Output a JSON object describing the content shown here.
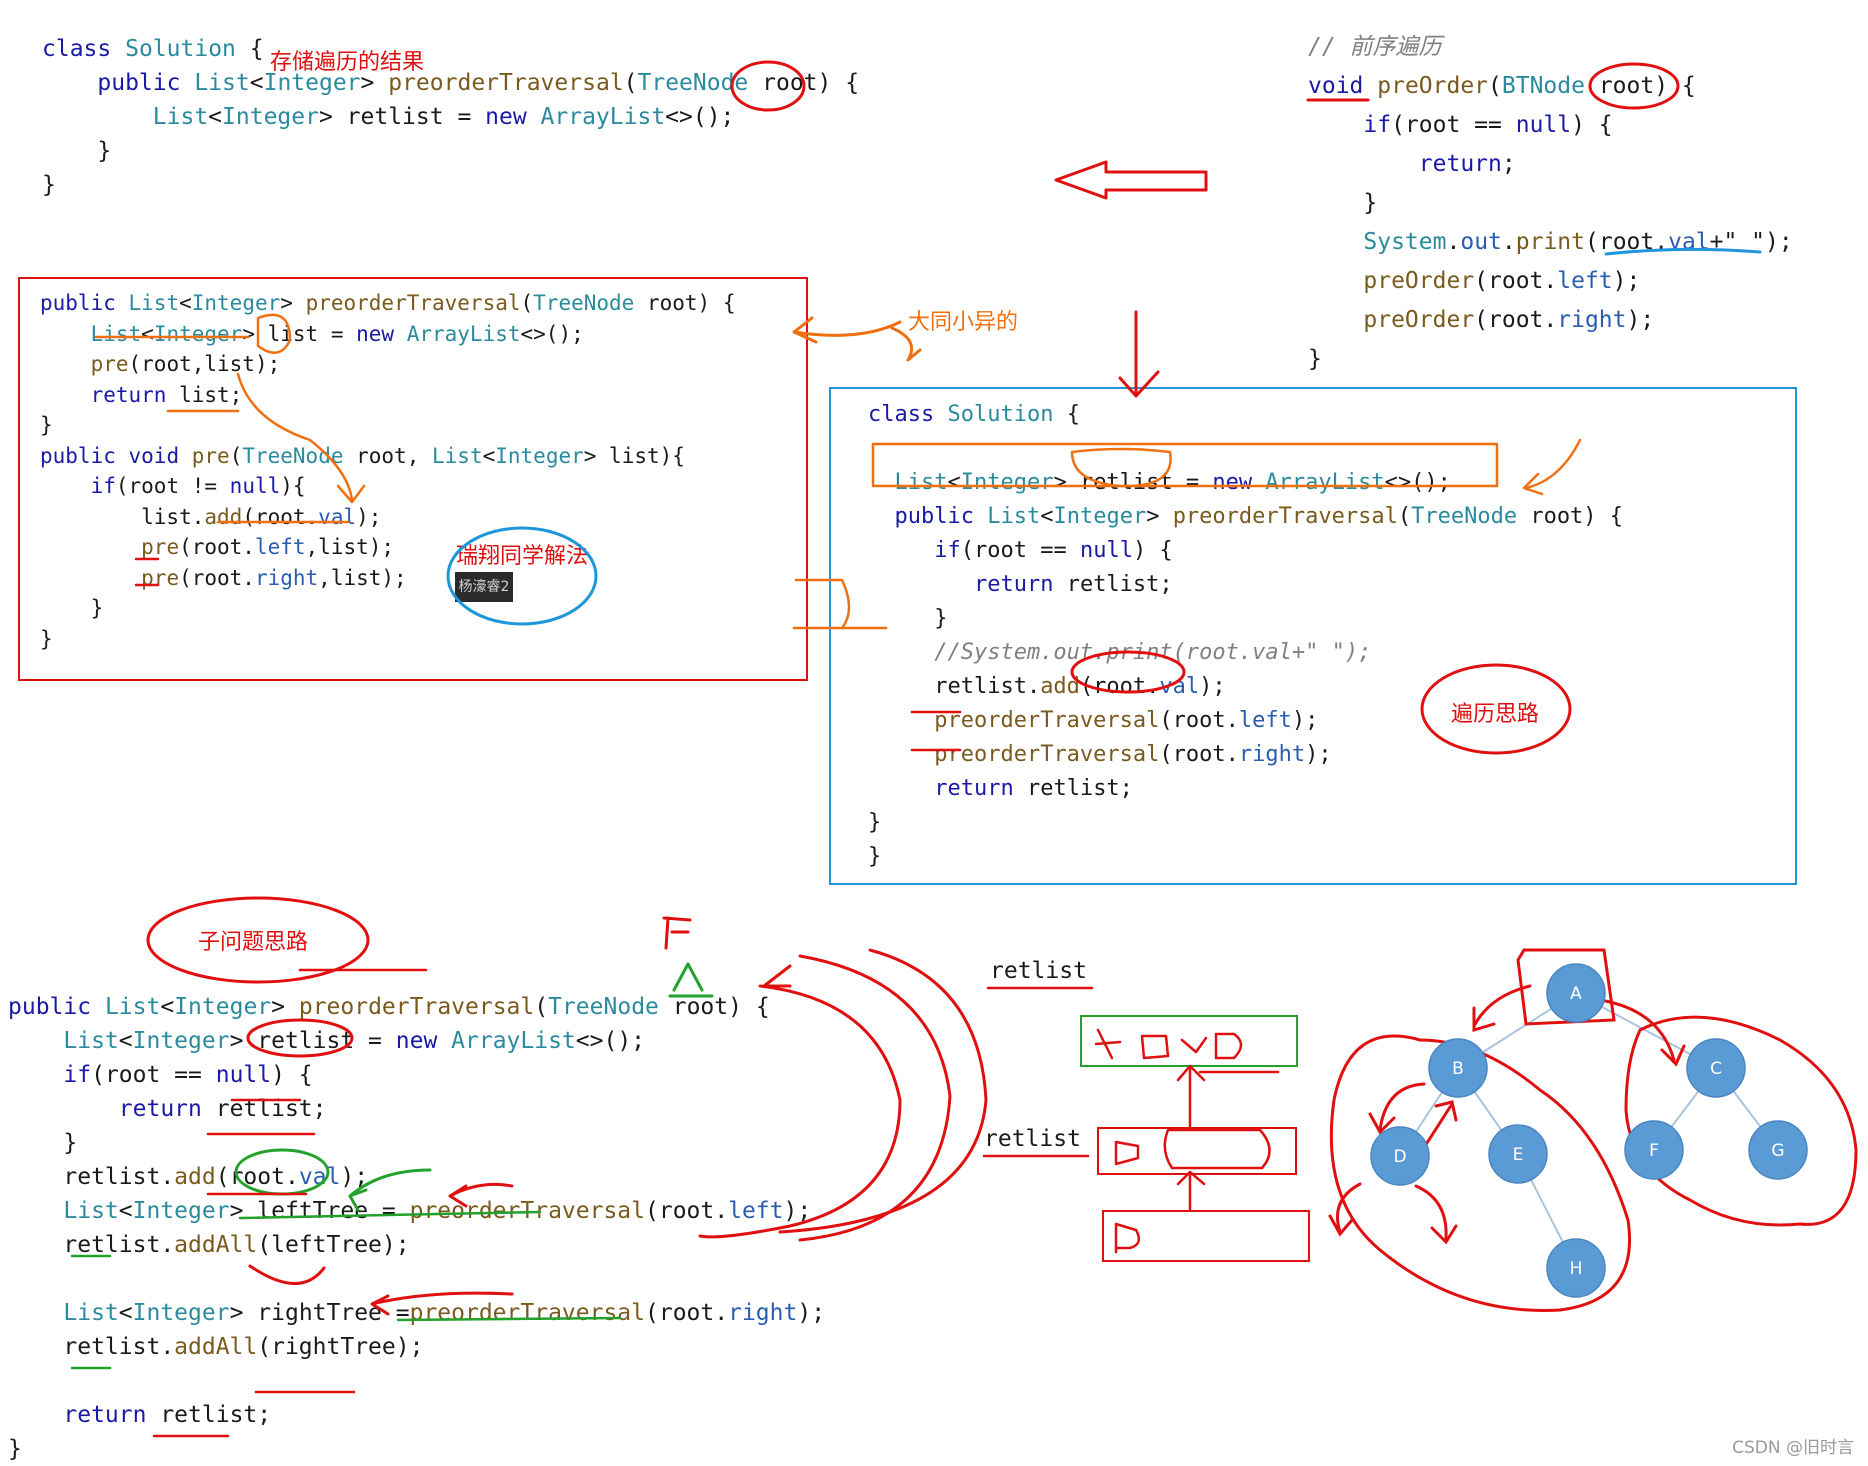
{
  "panel_top_left": {
    "lines": [
      "class Solution {",
      "    public List<Integer> preorderTraversal(TreeNode root) {",
      "        List<Integer> retlist = new ArrayList<>();",
      "    }",
      "}"
    ]
  },
  "panel_top_right": {
    "lines": [
      "// 前序遍历",
      "void preOrder(BTNode root) {",
      "    if(root == null) {",
      "        return;",
      "    }",
      "    System.out.print(root.val+\" \");",
      "    preOrder(root.left);",
      "    preOrder(root.right);",
      "}"
    ]
  },
  "panel_red_box": {
    "lines": [
      "public List<Integer> preorderTraversal(TreeNode root) {",
      "    List<Integer> list = new ArrayList<>();",
      "    pre(root,list);",
      "    return list;",
      "}",
      "public void pre(TreeNode root, List<Integer> list){",
      "    if(root != null){",
      "        list.add(root.val);",
      "        pre(root.left,list);",
      "        pre(root.right,list);",
      "    }",
      "}"
    ],
    "tooltip": "杨濠睿2"
  },
  "panel_blue_box": {
    "lines": [
      "class Solution {",
      "",
      "  List<Integer> retlist = new ArrayList<>();",
      "  public List<Integer> preorderTraversal(TreeNode root) {",
      "     if(root == null) {",
      "        return retlist;",
      "     }",
      "     //System.out.print(root.val+\" \");",
      "     retlist.add(root.val);",
      "     preorderTraversal(root.left);",
      "     preorderTraversal(root.right);",
      "     return retlist;",
      "}",
      "}"
    ]
  },
  "panel_bottom_left": {
    "lines": [
      "public List<Integer> preorderTraversal(TreeNode root) {",
      "    List<Integer> retlist = new ArrayList<>();",
      "    if(root == null) {",
      "        return retlist;",
      "    }",
      "    retlist.add(root.val);",
      "    List<Integer> leftTree = preorderTraversal(root.left);",
      "    retlist.addAll(leftTree);",
      "",
      "    List<Integer> rightTree =preorderTraversal(root.right);",
      "    retlist.addAll(rightTree);",
      "",
      "    return retlist;",
      "}"
    ]
  },
  "annotations": {
    "store_result": "存储遍历的结果",
    "similar": "大同小异的",
    "ruixiang": "瑞翔同学解法",
    "traversal_idea": "遍历思路",
    "subproblem_idea": "子问题思路"
  },
  "retlist_labels": [
    "retlist",
    "retlist"
  ],
  "tree": {
    "nodes": [
      "A",
      "B",
      "C",
      "D",
      "E",
      "F",
      "G",
      "H"
    ],
    "edges": [
      [
        "A",
        "B"
      ],
      [
        "A",
        "C"
      ],
      [
        "B",
        "D"
      ],
      [
        "B",
        "E"
      ],
      [
        "C",
        "F"
      ],
      [
        "C",
        "G"
      ],
      [
        "E",
        "H"
      ]
    ],
    "node_color": "#5b9bd5"
  },
  "watermark": "CSDN @旧时言",
  "colors": {
    "keyword": "#1a1aa6",
    "type": "#2b8a9e",
    "method": "#7a5a1e",
    "comment": "#808080",
    "annotation_red": "#e01010",
    "annotation_orange": "#f07010",
    "annotation_blue": "#1e96dc",
    "annotation_green": "#22a22a"
  }
}
